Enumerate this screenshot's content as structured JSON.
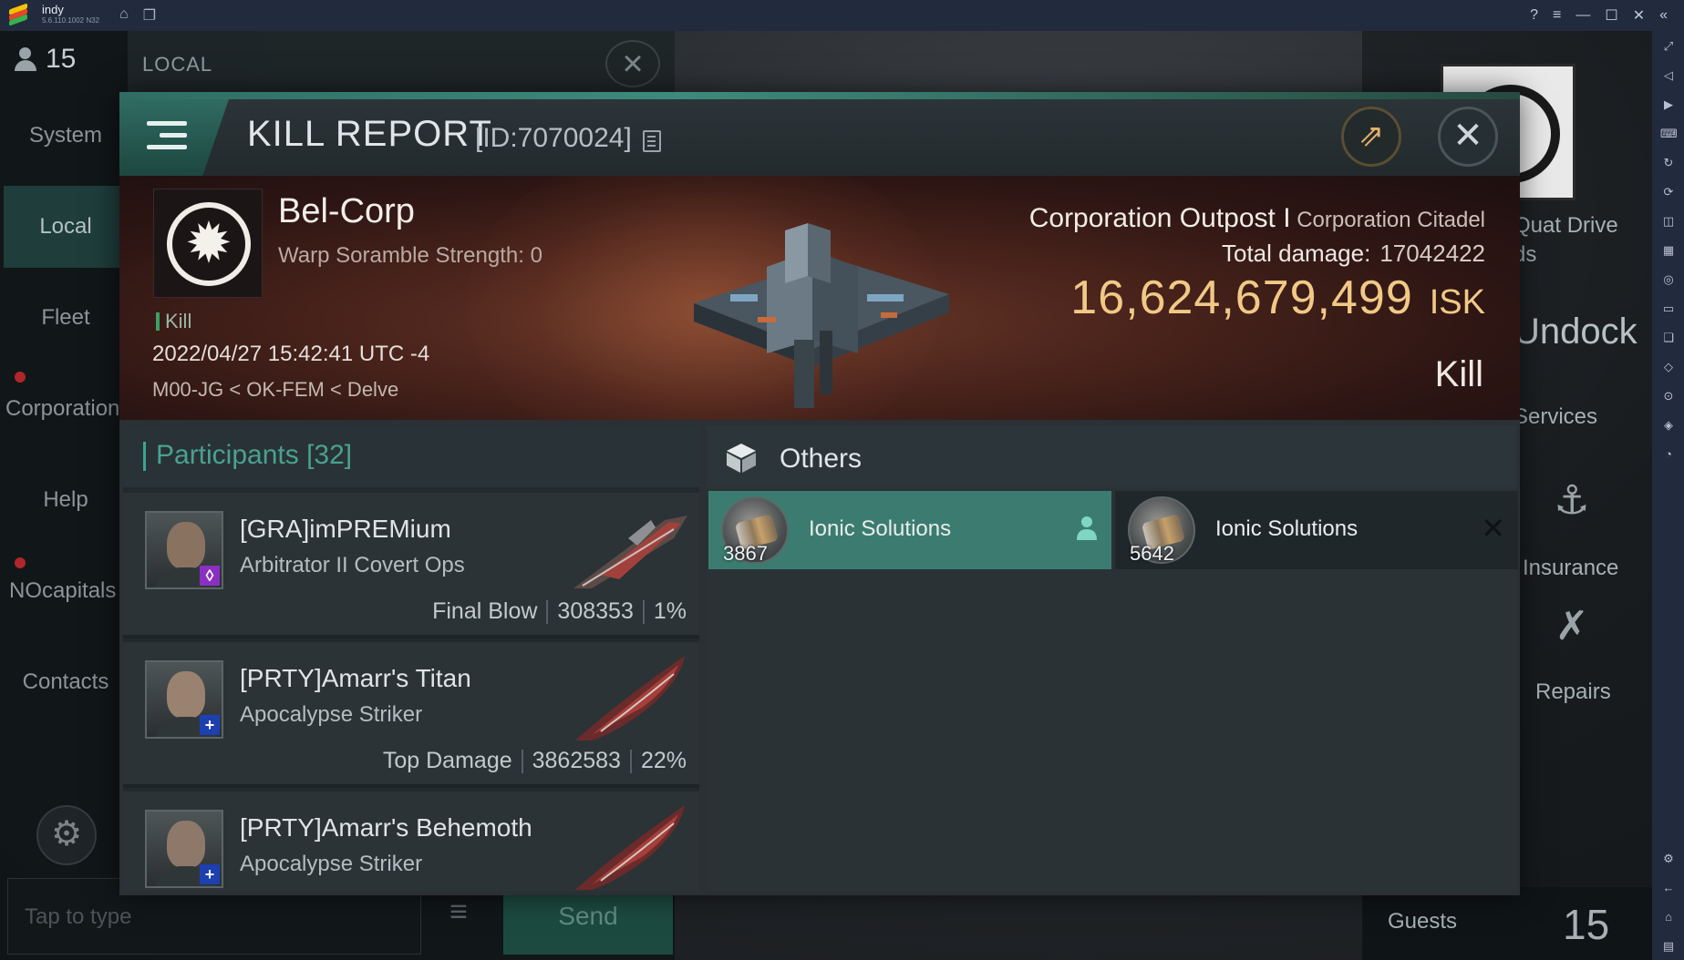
{
  "emulator": {
    "app_name": "indy",
    "version": "5.6.110.1002 N32",
    "colors": {
      "bar": "#222a3d",
      "text": "#c3cad8"
    },
    "nav_icons": [
      "home-icon",
      "multi-instance-icon"
    ],
    "window_icons": [
      "help-icon",
      "menu-icon",
      "minimize-icon",
      "maximize-icon",
      "close-icon",
      "collapse-icon"
    ],
    "side_icons": [
      "fullscreen-icon",
      "volume-icon",
      "media-icon",
      "keyboard-icon",
      "rotate-icon",
      "sync-icon",
      "gamepad-icon",
      "apk-icon",
      "screenshot-icon",
      "folder-icon",
      "copy-icon",
      "erase-icon",
      "location-icon",
      "layers-icon",
      "eco-icon",
      "settings-icon",
      "back-icon",
      "home-icon",
      "recent-icon"
    ]
  },
  "chat": {
    "member_count": "15",
    "channel_label": "LOCAL",
    "tabs": [
      {
        "label": "System",
        "active": false,
        "alert": false
      },
      {
        "label": "Local",
        "active": true,
        "alert": false
      },
      {
        "label": "Fleet",
        "active": false,
        "alert": false
      },
      {
        "label": "Corporation",
        "active": false,
        "alert": true
      },
      {
        "label": "Help",
        "active": false,
        "alert": false
      },
      {
        "label": "NOcapitals",
        "active": false,
        "alert": true
      },
      {
        "label": "Contacts",
        "active": false,
        "alert": false
      }
    ],
    "input_placeholder": "Tap to type",
    "send_label": "Send"
  },
  "station_panel": {
    "undock_label": "Undock",
    "drive_text": "Quat Drive",
    "drive_sub": "ds",
    "services_label": "Services",
    "insurance_label": "Insurance",
    "repairs_label": "Repairs",
    "guests_label": "Guests",
    "guests_count": "15"
  },
  "kill_report": {
    "title": "KILL REPORT",
    "id_text": "[ID:7070024]",
    "victim": {
      "corp_name": "Bel-Corp",
      "scramble_text": "Warp Soramble Strength: 0",
      "tag": "Kill",
      "timestamp": "2022/04/27 15:42:41 UTC -4",
      "location": "M00-JG < OK-FEM < Delve",
      "ship_name": "Corporation Outpost I",
      "ship_class": "Corporation Citadel",
      "total_damage_label": "Total damage:",
      "total_damage": "17042422",
      "isk_value": "16,624,679,499",
      "isk_unit": "ISK",
      "result": "Kill"
    },
    "participants": {
      "label": "Participants",
      "count": "[32]",
      "list": [
        {
          "name": "[GRA]imPREMium",
          "ship": "Arbitrator II Covert Ops",
          "role": "Final Blow",
          "damage": "308353",
          "percent": "1%",
          "badge_color": "#8a2fc2",
          "badge_icon": "diamond-icon"
        },
        {
          "name": "[PRTY]Amarr's Titan",
          "ship": "Apocalypse Striker",
          "role": "Top Damage",
          "damage": "3862583",
          "percent": "22%",
          "badge_color": "#1d3fb0",
          "badge_icon": "plus-icon"
        },
        {
          "name": "[PRTY]Amarr's Behemoth",
          "ship": "Apocalypse Striker",
          "role": "",
          "damage": "",
          "percent": "",
          "badge_color": "#1d3fb0",
          "badge_icon": "plus-icon"
        }
      ]
    },
    "others": {
      "label": "Others",
      "items": [
        {
          "name": "Ionic Solutions",
          "qty": "3867",
          "selected": true,
          "icon": "person-icon"
        },
        {
          "name": "Ionic Solutions",
          "qty": "5642",
          "selected": false,
          "icon": "destroyed-x-icon"
        }
      ]
    },
    "colors": {
      "accent": "#3aa592",
      "isk": "#f1c986",
      "banner": "#4b241c"
    }
  }
}
